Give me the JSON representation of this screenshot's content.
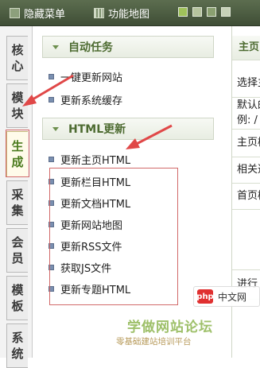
{
  "topbar": {
    "hide_menu": "隐藏菜单",
    "function_map": "功能地图"
  },
  "sidebar_tabs": [
    {
      "line1": "核",
      "line2": "心"
    },
    {
      "line1": "模",
      "line2": "块"
    },
    {
      "line1": "生",
      "line2": "成"
    },
    {
      "line1": "采",
      "line2": "集"
    },
    {
      "line1": "会",
      "line2": "员"
    },
    {
      "line1": "模",
      "line2": "板"
    },
    {
      "line1": "系",
      "line2": "统"
    }
  ],
  "menu": {
    "section1": {
      "title": "自动任务",
      "items": [
        "一键更新网站",
        "更新系统缓存"
      ]
    },
    "section2": {
      "title": "HTML更新",
      "items": [
        "更新主页HTML",
        "更新栏目HTML",
        "更新文档HTML",
        "更新网站地图",
        "更新RSS文件",
        "获取JS文件",
        "更新专题HTML"
      ]
    }
  },
  "right_panel": {
    "header": "主页",
    "rows": [
      "选择主",
      "默认的",
      "例: /",
      "主页模",
      "相关选",
      "首页模",
      "进行"
    ]
  },
  "watermark": {
    "line1": "学做网站论坛",
    "line2": "零基础建站培训平台",
    "badge_logo": "php",
    "badge_text": "中文网"
  }
}
